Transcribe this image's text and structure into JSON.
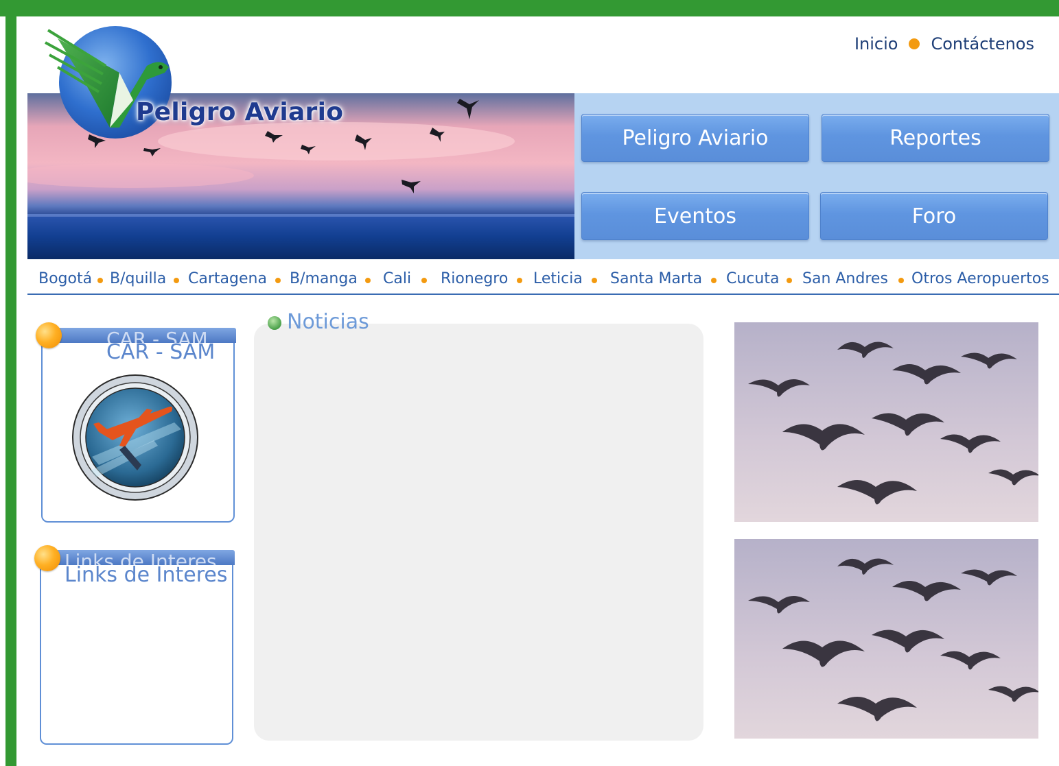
{
  "header": {
    "top_links": [
      "Inicio",
      "Contáctenos"
    ],
    "logo_title": "Peligro Aviario"
  },
  "nav_buttons": [
    "Peligro Aviario",
    "Reportes",
    "Eventos",
    "Foro"
  ],
  "airports": [
    "Bogotá",
    "B/quilla",
    "Cartagena",
    "B/manga",
    "Cali",
    "Rionegro",
    "Leticia",
    "Santa Marta",
    "Cucuta",
    "San Andres",
    "Otros Aeropuertos"
  ],
  "sidebar": {
    "car_sam": {
      "bar_label": "CAR - SAM",
      "title": "CAR - SAM"
    },
    "links": {
      "bar_label": "Links de Interes",
      "title": "Links de Interes"
    }
  },
  "news": {
    "title": "Noticias"
  },
  "colors": {
    "frame_green": "#339933",
    "link_blue": "#2c5ea8",
    "accent_orange": "#f39a10",
    "nav_button_blue": "#5f95e0",
    "panel_light_blue": "#b6d3f2"
  }
}
